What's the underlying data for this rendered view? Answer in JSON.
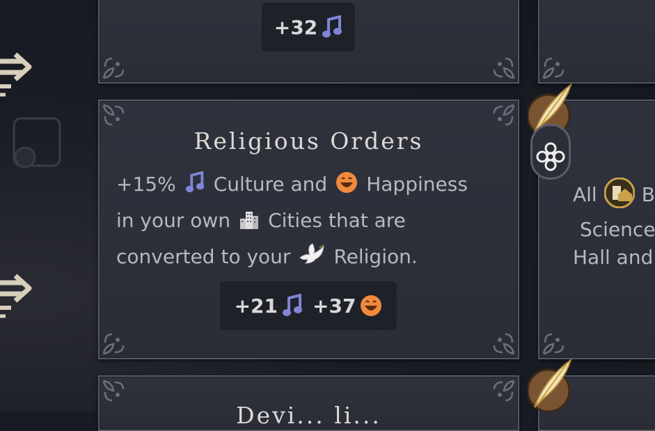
{
  "top_card": {
    "yield_value": "+32"
  },
  "main_card": {
    "title": "Religious Orders",
    "desc": {
      "line1_a": "+15%",
      "line1_b": "Culture and",
      "line1_c": "Happiness",
      "line2_a": "in your own",
      "line2_b": "Cities that are",
      "line3_a": "converted to your",
      "line3_b": "Religion."
    },
    "yields": {
      "culture": "+21",
      "happiness": "+37"
    }
  },
  "right_card": {
    "line1_a": "All",
    "line1_b": "B",
    "line2": "Science",
    "line3": "Hall and"
  },
  "bottom_card": {
    "title_partial": "Devi... li..."
  },
  "colors": {
    "culture": "#7f86d6",
    "happiness": "#f08a3c",
    "gold": "#c9a24a"
  }
}
